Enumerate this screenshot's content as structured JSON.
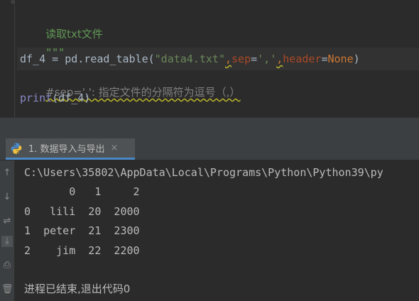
{
  "editor": {
    "lines": {
      "comment_title": "读取txt文件",
      "docstring_open": "\"\"\"",
      "code_var": "df_4",
      "code_eq": " = ",
      "code_call": "pd.read_table(",
      "code_arg_str": "\"data4.txt\"",
      "code_comma1": ",",
      "code_kw1": "sep",
      "code_eq2": "=",
      "code_sep_val": "','",
      "code_comma2": ",",
      "code_kw2": "header",
      "code_eq3": "=",
      "code_none": "None",
      "code_close": ")",
      "hash_comment": "#sep=',': 指定文件的分隔符为逗号（,）",
      "print_func": "print",
      "print_args": "(df_4)",
      "docstring_close": "\"\"\""
    }
  },
  "run_panel": {
    "tab_label": "1. 数据导入与导出",
    "tab_close": "×"
  },
  "console": {
    "path_line": "C:\\Users\\35802\\AppData\\Local\\Programs\\Python\\Python39\\py",
    "header_row": "       0   1     2",
    "rows": [
      "0   lili  20  2000",
      "1  peter  21  2300",
      "2    jim  22  2200"
    ],
    "exit_message": "进程已结束,退出代码0"
  },
  "toolbar_icons": [
    "up-arrow-icon",
    "down-arrow-icon",
    "soft-wrap-icon",
    "scroll-to-end-icon",
    "print-icon",
    "trash-icon"
  ]
}
